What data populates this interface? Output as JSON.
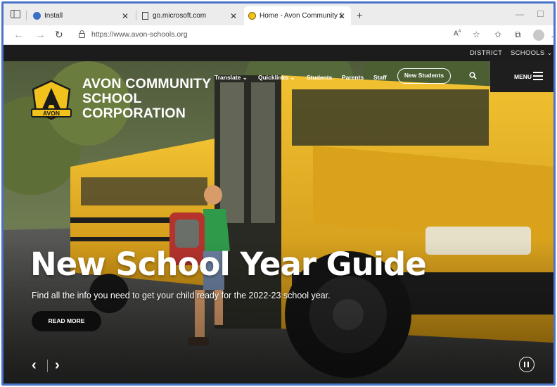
{
  "browser": {
    "tabs": [
      {
        "title": "Install",
        "active": false
      },
      {
        "title": "go.microsoft.com",
        "active": false
      },
      {
        "title": "Home - Avon Community Schoo",
        "active": true
      }
    ],
    "new_tab_label": "+",
    "url": "https://www.avon-schools.org",
    "icons": [
      "tab-actions-icon",
      "back-icon",
      "forward-icon",
      "refresh-icon",
      "lock-icon",
      "read-aloud-icon",
      "favorite-icon",
      "favorites-icon",
      "collections-icon",
      "profile-icon",
      "more-icon"
    ]
  },
  "site": {
    "top_links": {
      "district": "DISTRICT",
      "schools": "SCHOOLS"
    },
    "school_name": [
      "AVON COMMUNITY",
      "SCHOOL",
      "CORPORATION"
    ],
    "logo_text": "AVON",
    "nav": {
      "translate": "Translate",
      "quicklinks": "Quicklinks",
      "students": "Students",
      "parents": "Parents",
      "staff": "Staff",
      "new_students": "New Students",
      "menu": "MENU"
    },
    "hero": {
      "headline": "New School Year Guide",
      "subline": "Find all the info you need to get your child ready for the 2022-23 school year.",
      "cta": "READ MORE",
      "prev": "‹",
      "next": "›"
    },
    "colors": {
      "accent_blue": "#4a74c9",
      "bus_yellow": "#e8b21a",
      "logo_gold": "#f1c21b"
    }
  }
}
